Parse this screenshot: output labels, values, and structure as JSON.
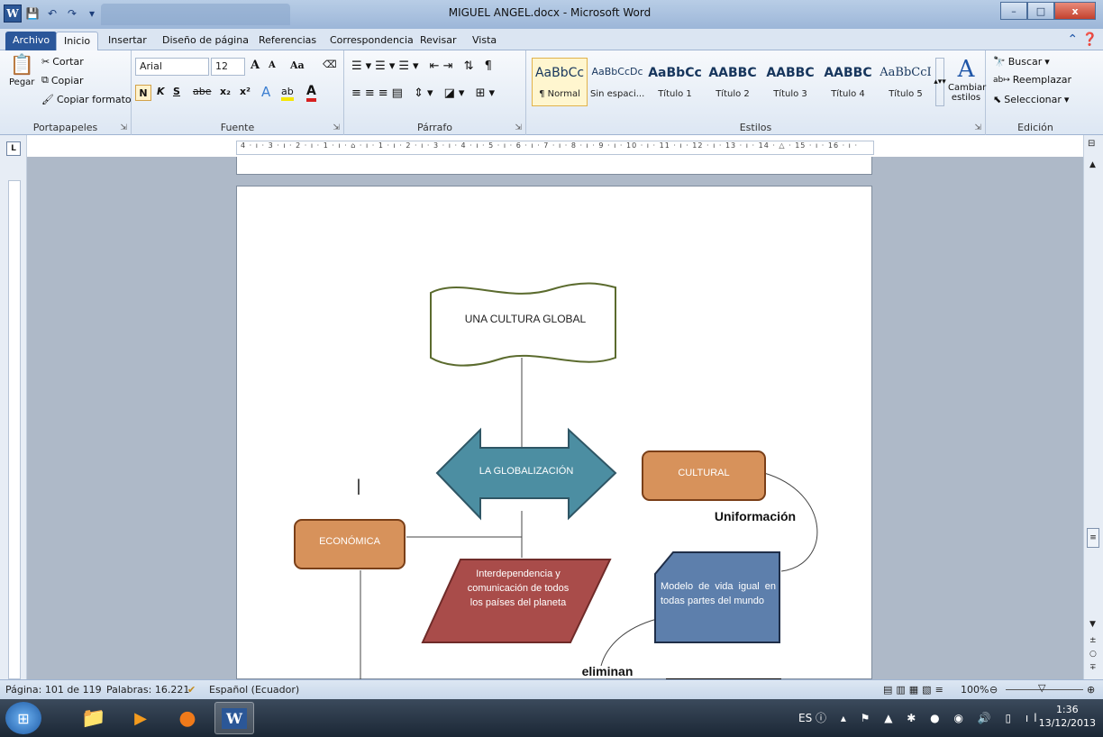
{
  "titlebar": {
    "doc_title": "MIGUEL ANGEL.docx - Microsoft Word",
    "word_icon": "W",
    "minimize": "–",
    "maximize": "□",
    "close": "x"
  },
  "tabs": [
    "Archivo",
    "Inicio",
    "Insertar",
    "Diseño de página",
    "Referencias",
    "Correspondencia",
    "Revisar",
    "Vista"
  ],
  "ribbon": {
    "portapapeles": {
      "paste": "Pegar",
      "cut": "Cortar",
      "copy": "Copiar",
      "format_painter": "Copiar formato",
      "label": "Portapapeles"
    },
    "fuente": {
      "font": "Arial",
      "size": "12",
      "grow": "A",
      "shrink": "A",
      "case": "Aa",
      "bold": "N",
      "italic": "K",
      "underline": "S",
      "strike": "abe",
      "sub": "x₂",
      "sup": "x²",
      "label": "Fuente"
    },
    "parrafo": {
      "label": "Párrafo"
    },
    "estilos": {
      "items": [
        {
          "preview": "AaBbCc",
          "name": "¶ Normal"
        },
        {
          "preview": "AaBbCcDc",
          "name": "Sin espaci..."
        },
        {
          "preview": "AaBbCc",
          "name": "Título 1"
        },
        {
          "preview": "AABBC",
          "name": "Título 2"
        },
        {
          "preview": "AABBC",
          "name": "Título 3"
        },
        {
          "preview": "AABBC",
          "name": "Título 4"
        },
        {
          "preview": "AaBbCcI",
          "name": "Título 5"
        }
      ],
      "change_styles": "Cambiar estilos",
      "label": "Estilos"
    },
    "edicion": {
      "find": "Buscar",
      "replace": "Reemplazar",
      "select": "Seleccionar",
      "label": "Edición"
    }
  },
  "ruler_marks": "4 · ı · 3 · ı · 2 · ı · 1 · ı · ⌂ · ı · 1 · ı · 2 · ı · 3 · ı · 4 · ı · 5 · ı · 6 · ı · 7 · ı · 8 · ı · 9 · ı · 10 · ı · 11 · ı · 12 · ı · 13 · ı · 14 · △ · 15 · ı · 16 · ı ·",
  "diagram": {
    "top": "UNA CULTURA GLOBAL",
    "center": "LA GLOBALIZACIÓN",
    "right": "CULTURAL",
    "left": "ECONÓMICA",
    "uniform_label": "Uniformación",
    "parallelogram": "Interdependencia y comunicación de todos los países del planeta",
    "pentagon": "Modelo de vida igual en todas partes del mundo",
    "eliminan_label": "eliminan",
    "cursor": "|"
  },
  "status": {
    "page": "Página: 101 de 119",
    "words": "Palabras: 16.221",
    "lang": "Español (Ecuador)",
    "zoom": "100%"
  },
  "taskbar": {
    "lang": "ES",
    "time": "1:36",
    "date": "13/12/2013"
  },
  "colors": {
    "titlebar": "#9cb6d8",
    "workspace": "#aeb9c8",
    "arrow_fill": "#4c8ea2",
    "orange_box": "#d7925b",
    "red_parallelogram": "#a94c4a",
    "blue_pentagon": "#5d7fac",
    "scroll_outline": "#5b6b2e"
  }
}
